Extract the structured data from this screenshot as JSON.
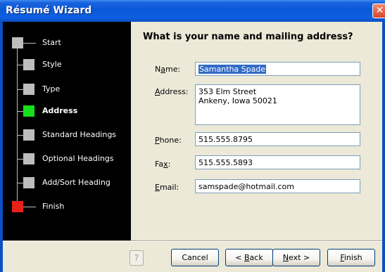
{
  "window": {
    "title": "Résumé Wizard",
    "close_glyph": "✕"
  },
  "steps": [
    {
      "label": "Start",
      "color": "#bdbdbd",
      "bold": false
    },
    {
      "label": "Style",
      "color": "#bdbdbd",
      "bold": false
    },
    {
      "label": "Type",
      "color": "#bdbdbd",
      "bold": false
    },
    {
      "label": "Address",
      "color": "#16e01a",
      "bold": true
    },
    {
      "label": "Standard Headings",
      "color": "#bdbdbd",
      "bold": false
    },
    {
      "label": "Optional Headings",
      "color": "#bdbdbd",
      "bold": false
    },
    {
      "label": "Add/Sort Heading",
      "color": "#bdbdbd",
      "bold": false
    },
    {
      "label": "Finish",
      "color": "#e8201a",
      "bold": false
    }
  ],
  "form": {
    "heading": "What is your name and mailing address?",
    "name": {
      "label_pre": "N",
      "label_ul": "a",
      "label_post": "me:",
      "value": "Samantha Spade"
    },
    "address": {
      "label_pre": "",
      "label_ul": "A",
      "label_post": "ddress:",
      "value": "353 Elm Street\nAnkeny, Iowa  50021"
    },
    "phone": {
      "label_pre": "",
      "label_ul": "P",
      "label_post": "hone:",
      "value": "515.555.8795"
    },
    "fax": {
      "label_pre": "Fa",
      "label_ul": "x",
      "label_post": ":",
      "value": "515.555.5893"
    },
    "email": {
      "label_pre": "",
      "label_ul": "E",
      "label_post": "mail:",
      "value": "samspade@hotmail.com"
    }
  },
  "buttons": {
    "help_glyph": "?",
    "cancel": "Cancel",
    "back_pre": "< ",
    "back_ul": "B",
    "back_post": "ack",
    "next_ul": "N",
    "next_post": "ext >",
    "finish_ul": "F",
    "finish_post": "inish"
  }
}
